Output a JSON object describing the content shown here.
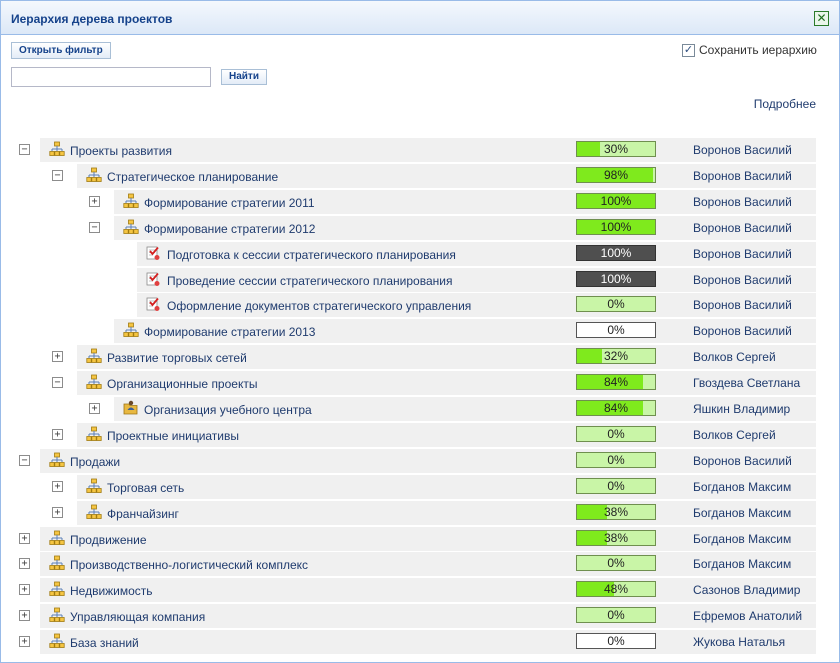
{
  "window": {
    "title": "Иерархия дерева проектов"
  },
  "toolbar": {
    "filter_label": "Открыть фильтр",
    "save_hierarchy_label": "Сохранить иерархию",
    "save_hierarchy_checked": true,
    "search_value": "",
    "find_label": "Найти",
    "more_label": "Подробнее"
  },
  "colors": {
    "progress_fill": "#7fea1d",
    "progress_track": "#c9f5a7",
    "progress_dark": "#4f4f4f",
    "link": "#1f3b6e"
  },
  "rows": [
    {
      "label": "Проекты развития",
      "owner": "Воронов Василий",
      "percent": 30,
      "progress_text": "30%",
      "style": "green",
      "toggle": "minus",
      "icon": "hierarchy-icon",
      "level": 0
    },
    {
      "label": "Стратегическое планирование",
      "owner": "Воронов Василий",
      "percent": 98,
      "progress_text": "98%",
      "style": "green",
      "toggle": "minus",
      "icon": "hierarchy-icon",
      "level": 1
    },
    {
      "label": "Формирование стратегии 2011",
      "owner": "Воронов Василий",
      "percent": 100,
      "progress_text": "100%",
      "style": "green",
      "toggle": "plus",
      "icon": "hierarchy-icon",
      "level": 2
    },
    {
      "label": "Формирование стратегии 2012",
      "owner": "Воронов Василий",
      "percent": 100,
      "progress_text": "100%",
      "style": "green",
      "toggle": "minus",
      "icon": "hierarchy-icon",
      "level": 2
    },
    {
      "label": "Подготовка к сессии стратегического планирования",
      "owner": "Воронов Василий",
      "percent": 100,
      "progress_text": "100%",
      "style": "dark",
      "toggle": "none",
      "icon": "task-icon",
      "level": 3
    },
    {
      "label": "Проведение сессии стратегического планирования",
      "owner": "Воронов Василий",
      "percent": 100,
      "progress_text": "100%",
      "style": "dark",
      "toggle": "none",
      "icon": "task-icon",
      "level": 3
    },
    {
      "label": "Оформление документов стратегического управления",
      "owner": "Воронов Василий",
      "percent": 0,
      "progress_text": "0%",
      "style": "green",
      "toggle": "none",
      "icon": "task-icon",
      "level": 3
    },
    {
      "label": "Формирование стратегии 2013",
      "owner": "Воронов Василий",
      "percent": 0,
      "progress_text": "0%",
      "style": "white",
      "toggle": "none",
      "icon": "hierarchy-icon",
      "level": 2
    },
    {
      "label": "Развитие торговых сетей",
      "owner": "Волков Сергей",
      "percent": 32,
      "progress_text": "32%",
      "style": "green",
      "toggle": "plus",
      "icon": "hierarchy-icon",
      "level": 1
    },
    {
      "label": "Организационные проекты",
      "owner": "Гвоздева Светлана",
      "percent": 84,
      "progress_text": "84%",
      "style": "green",
      "toggle": "minus",
      "icon": "hierarchy-icon",
      "level": 1
    },
    {
      "label": "Организация учебного центра",
      "owner": "Яшкин Владимир",
      "percent": 84,
      "progress_text": "84%",
      "style": "green",
      "toggle": "plus",
      "icon": "folder-user-icon",
      "level": 2
    },
    {
      "label": "Проектные инициативы",
      "owner": "Волков Сергей",
      "percent": 0,
      "progress_text": "0%",
      "style": "green",
      "toggle": "plus",
      "icon": "hierarchy-icon",
      "level": 1
    },
    {
      "label": "Продажи",
      "owner": "Воронов Василий",
      "percent": 0,
      "progress_text": "0%",
      "style": "green",
      "toggle": "minus",
      "icon": "hierarchy-icon",
      "level": 0
    },
    {
      "label": "Торговая сеть",
      "owner": "Богданов Максим",
      "percent": 0,
      "progress_text": "0%",
      "style": "green",
      "toggle": "plus",
      "icon": "hierarchy-icon",
      "level": 1
    },
    {
      "label": "Франчайзинг",
      "owner": "Богданов Максим",
      "percent": 38,
      "progress_text": "38%",
      "style": "green",
      "toggle": "plus",
      "icon": "hierarchy-icon",
      "level": 1
    },
    {
      "label": "Продвижение",
      "owner": "Богданов Максим",
      "percent": 38,
      "progress_text": "38%",
      "style": "green",
      "toggle": "plus",
      "icon": "hierarchy-icon",
      "level": 0
    },
    {
      "label": "Производственно-логистический комплекс",
      "owner": "Богданов Максим",
      "percent": 0,
      "progress_text": "0%",
      "style": "green",
      "toggle": "plus",
      "icon": "hierarchy-icon",
      "level": 0
    },
    {
      "label": "Недвижимость",
      "owner": "Сазонов Владимир",
      "percent": 48,
      "progress_text": "48%",
      "style": "green",
      "toggle": "plus",
      "icon": "hierarchy-icon",
      "level": 0
    },
    {
      "label": "Управляющая компания",
      "owner": "Ефремов Анатолий",
      "percent": 0,
      "progress_text": "0%",
      "style": "green",
      "toggle": "plus",
      "icon": "hierarchy-icon",
      "level": 0
    },
    {
      "label": "База знаний",
      "owner": "Жукова Наталья",
      "percent": 0,
      "progress_text": "0%",
      "style": "white",
      "toggle": "plus",
      "icon": "hierarchy-icon",
      "level": 0
    }
  ]
}
